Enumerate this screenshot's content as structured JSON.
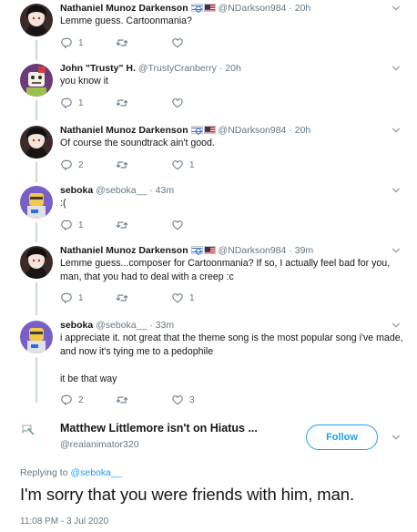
{
  "tweets": [
    {
      "name": "Nathaniel Munoz Darkenson",
      "handle": "@NDarkson984",
      "time": "20h",
      "text": "Lemme guess. Cartoonmania?",
      "replies": "1",
      "retweets": "",
      "likes": ""
    },
    {
      "name": "John \"Trusty\" H.",
      "handle": "@TrustyCranberry",
      "time": "20h",
      "text": "you know it",
      "replies": "1",
      "retweets": "",
      "likes": ""
    },
    {
      "name": "Nathaniel Munoz Darkenson",
      "handle": "@NDarkson984",
      "time": "20h",
      "text": "Of course the soundtrack ain't good.",
      "replies": "2",
      "retweets": "",
      "likes": "1"
    },
    {
      "name": "seboka",
      "handle": "@seboka__",
      "time": "43m",
      "text": ":(",
      "replies": "1",
      "retweets": "",
      "likes": ""
    },
    {
      "name": "Nathaniel Munoz Darkenson",
      "handle": "@NDarkson984",
      "time": "39m",
      "text_lines": [
        "Lemme guess...composer for Cartoonmania? If so, I actually feel bad for you,",
        "man, that you had to deal with a creep :c"
      ],
      "replies": "1",
      "retweets": "",
      "likes": "1"
    },
    {
      "name": "seboka",
      "handle": "@seboka__",
      "time": "33m",
      "text_lines": [
        "i appreciate it. not great that the theme song is the most popular song i've made,",
        "and now it's tying me to a pedophile",
        "",
        "it be that way"
      ],
      "replies": "2",
      "retweets": "",
      "likes": "3"
    }
  ],
  "main_tweet": {
    "name": "Matthew Littlemore isn't on Hiatus ...",
    "handle": "@realanimator320",
    "follow_label": "Follow",
    "replying_prefix": "Replying to",
    "replying_to": "@seboka__",
    "text": "I'm sorry that you were friends with him, man.",
    "timestamp": "11:08 PM - 3 Jul 2020"
  },
  "separator": "·",
  "colors": {
    "accent": "#1da1f2",
    "secondary_text": "#657786",
    "thread_line": "#ccd6dd"
  },
  "icons": [
    "reply-icon",
    "retweet-icon",
    "like-icon",
    "chevron-down-icon",
    "broken-image-icon",
    "israel-flag-icon",
    "us-flag-icon"
  ]
}
